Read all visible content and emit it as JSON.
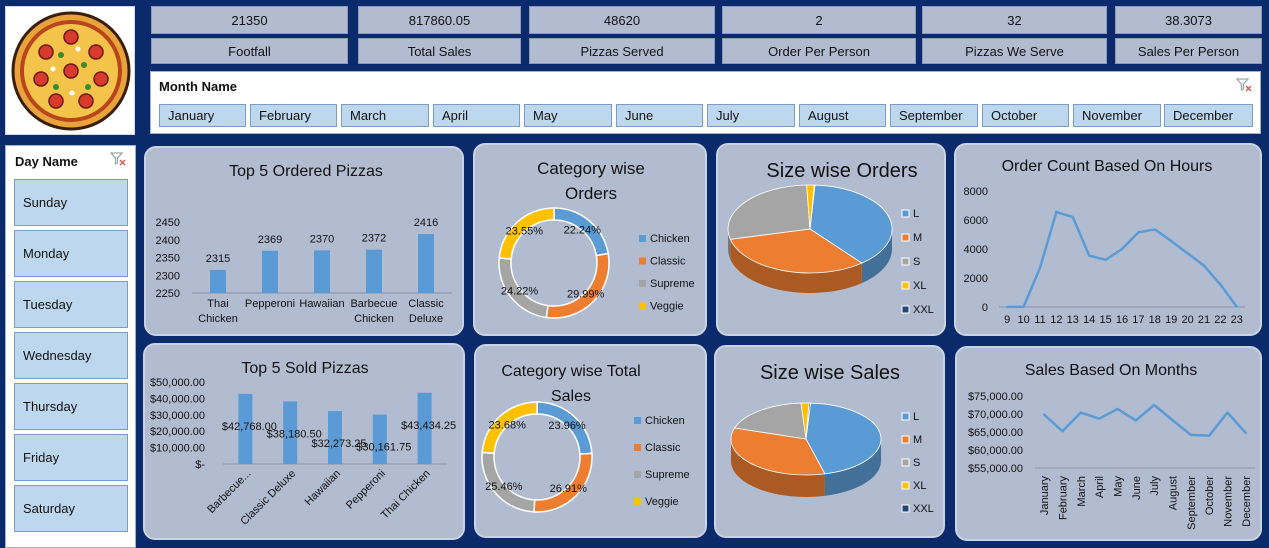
{
  "kpis": [
    {
      "value": "21350",
      "label": "Footfall"
    },
    {
      "value": "817860.05",
      "label": "Total Sales"
    },
    {
      "value": "48620",
      "label": "Pizzas Served"
    },
    {
      "value": "2",
      "label": "Order Per Person"
    },
    {
      "value": "32",
      "label": "Pizzas We Serve"
    },
    {
      "value": "38.3073",
      "label": "Sales Per Person"
    }
  ],
  "month_slicer": {
    "title": "Month Name",
    "items": [
      "January",
      "February",
      "March",
      "April",
      "May",
      "June",
      "July",
      "August",
      "September",
      "October",
      "November",
      "December"
    ]
  },
  "day_slicer": {
    "title": "Day Name",
    "items": [
      "Sunday",
      "Monday",
      "Tuesday",
      "Wednesday",
      "Thursday",
      "Friday",
      "Saturday"
    ]
  },
  "colors": {
    "background": "#0b2a6b",
    "card": "#b2bcd1",
    "bar": "#5b9bd5",
    "chicken": "#5b9bd5",
    "classic": "#ed7d31",
    "supreme": "#a5a5a5",
    "veggie": "#ffc000",
    "xxl": "#264478",
    "slicer_button": "#bdd7ee"
  },
  "chart_data": [
    {
      "id": "top5-ordered",
      "type": "bar",
      "title": "Top 5 Ordered Pizzas",
      "categories": [
        "Thai Chicken",
        "Pepperoni",
        "Hawaiian",
        "Barbecue Chicken",
        "Classic Deluxe"
      ],
      "category_lines": [
        [
          "Thai",
          "Chicken"
        ],
        [
          "Pepperoni"
        ],
        [
          "Hawaiian"
        ],
        [
          "Barbecue",
          "Chicken"
        ],
        [
          "Classic",
          "Deluxe"
        ]
      ],
      "values": [
        2315,
        2369,
        2370,
        2372,
        2416
      ],
      "data_labels": [
        "2315",
        "2369",
        "2370",
        "2372",
        "2416"
      ],
      "y_ticks": [
        "2450",
        "2400",
        "2350",
        "2300",
        "2250"
      ],
      "ylim": [
        2250,
        2450
      ]
    },
    {
      "id": "category-orders",
      "type": "pie",
      "title_lines": [
        "Category wise",
        "Orders"
      ],
      "categories": [
        "Chicken",
        "Classic",
        "Supreme",
        "Veggie"
      ],
      "values": [
        22.24,
        29.99,
        24.22,
        23.55
      ],
      "data_labels": [
        "22.24%",
        "29.99%",
        "24.22%",
        "23.55%"
      ],
      "legend_position": "right"
    },
    {
      "id": "size-orders",
      "type": "pie",
      "title": "Size wise Orders",
      "categories": [
        "L",
        "M",
        "S",
        "XL",
        "XXL"
      ],
      "values": [
        38,
        32,
        28,
        1.5,
        0.1
      ],
      "legend_position": "right"
    },
    {
      "id": "hour-orders",
      "type": "line",
      "title": "Order Count Based On Hours",
      "x": [
        "9",
        "10",
        "11",
        "12",
        "13",
        "14",
        "15",
        "16",
        "17",
        "18",
        "19",
        "20",
        "21",
        "22",
        "23"
      ],
      "values": [
        4,
        17,
        2700,
        6550,
        6200,
        3550,
        3250,
        4000,
        5150,
        5350,
        4550,
        3700,
        2850,
        1550,
        20
      ],
      "y_ticks": [
        "8000",
        "6000",
        "4000",
        "2000",
        "0"
      ],
      "ylim": [
        0,
        8000
      ]
    },
    {
      "id": "top5-sold",
      "type": "bar",
      "title": "Top 5 Sold Pizzas",
      "categories": [
        "Barbecue...",
        "Classic Deluxe",
        "Hawaiian",
        "Pepperoni",
        "Thai Chicken"
      ],
      "values": [
        42768.0,
        38180.5,
        32273.25,
        30161.75,
        43434.25
      ],
      "data_labels": [
        "$42,768.00",
        "$38,180.50",
        "$32,273.25",
        "$30,161.75",
        "$43,434.25"
      ],
      "y_ticks": [
        "$50,000.00",
        "$40,000.00",
        "$30,000.00",
        "$20,000.00",
        "$10,000.00",
        "$-"
      ],
      "ylim": [
        0,
        50000
      ]
    },
    {
      "id": "category-sales",
      "type": "pie",
      "title_lines": [
        "Category wise Total",
        "Sales"
      ],
      "categories": [
        "Chicken",
        "Classic",
        "Supreme",
        "Veggie"
      ],
      "values": [
        23.96,
        26.91,
        25.46,
        23.68
      ],
      "data_labels": [
        "23.96%",
        "26.91%",
        "25.46%",
        "23.68%"
      ],
      "legend_position": "right"
    },
    {
      "id": "size-sales",
      "type": "pie",
      "title": "Size wise Sales",
      "categories": [
        "L",
        "M",
        "S",
        "XL",
        "XXL"
      ],
      "values": [
        45,
        34,
        19,
        1.7,
        0.3
      ],
      "legend_position": "right"
    },
    {
      "id": "month-sales",
      "type": "line",
      "title": "Sales Based On Months",
      "x": [
        "January",
        "February",
        "March",
        "April",
        "May",
        "June",
        "July",
        "August",
        "September",
        "October",
        "November",
        "December"
      ],
      "values": [
        69800,
        65200,
        70400,
        68700,
        71400,
        68200,
        72500,
        68300,
        64200,
        64000,
        70400,
        64700
      ],
      "y_ticks": [
        "$75,000.00",
        "$70,000.00",
        "$65,000.00",
        "$60,000.00",
        "$55,000.00"
      ],
      "ylim": [
        55000,
        75000
      ]
    }
  ]
}
